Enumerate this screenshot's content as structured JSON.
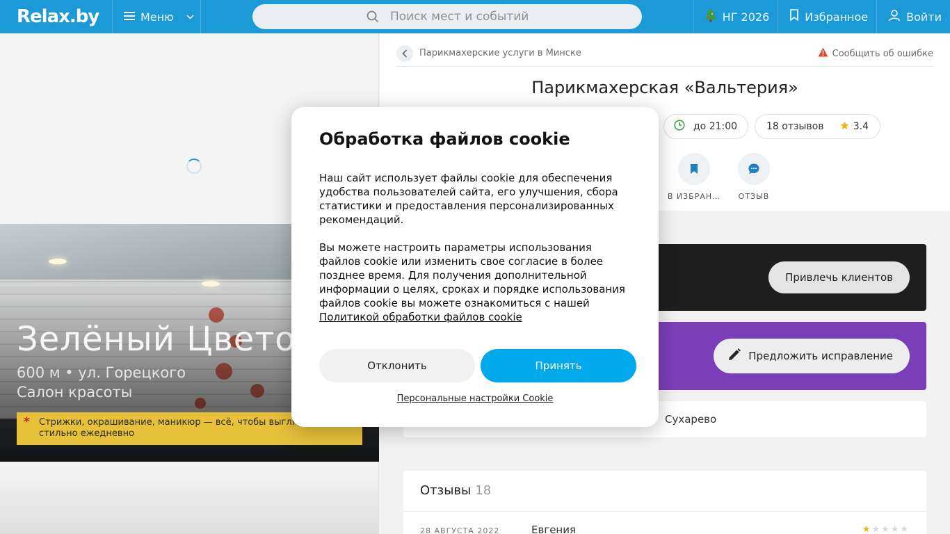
{
  "header": {
    "logo": "Relax.by",
    "menu_label": "Меню",
    "search_placeholder": "Поиск мест и событий",
    "ny_label": "НГ 2026",
    "favorites_label": "Избранное",
    "login_label": "Войти",
    "bg_color": "#1b9ad7"
  },
  "hero": {
    "title": "Зелёный Цветок",
    "location": "600 м • ул. Горецкого",
    "category": "Салон красоты",
    "note": "Стрижки, окрашивание, маникюр — всё, чтобы выглядеть стильно ежедневно"
  },
  "place": {
    "breadcrumb": "Парикмахерские услуги в Минске",
    "report": "Сообщить об ошибке",
    "title": "Парикмахерская «Вальтерия»",
    "hours": "до 21:00",
    "reviews_count": "18 отзывов",
    "rating": "3.4",
    "actions": [
      {
        "label": "В ИЗБРАН…",
        "icon": "bookmark-icon"
      },
      {
        "label": "ОТЗЫВ",
        "icon": "chat-icon"
      }
    ]
  },
  "promo": {
    "attract_button": "Привлечь клиентов",
    "suggest_button": "Предложить исправление"
  },
  "metro": {
    "name": "Сухарево"
  },
  "reviews": {
    "title": "Отзывы",
    "count": "18",
    "items": [
      {
        "date": "28 АВГУСТА 2022",
        "author": "Евгения",
        "stars": 1
      }
    ]
  },
  "cookie": {
    "title": "Обработка файлов cookie",
    "paragraph1": "Наш сайт использует файлы cookie для обеспечения удобства пользователей сайта, его улучшения, сбора статистики и предоставления персонализированных рекомендаций.",
    "paragraph2": "Вы можете настроить параметры использования файлов cookie или изменить свое согласие в более позднее время. Для получения дополнительной информации о целях, сроках и порядке использования файлов cookie вы можете ознакомиться с нашей",
    "policy_link": "Политикой обработки файлов cookie",
    "decline": "Отклонить",
    "accept": "Принять",
    "personal": "Персональные настройки Cookie",
    "accept_color": "#00a8ec"
  }
}
